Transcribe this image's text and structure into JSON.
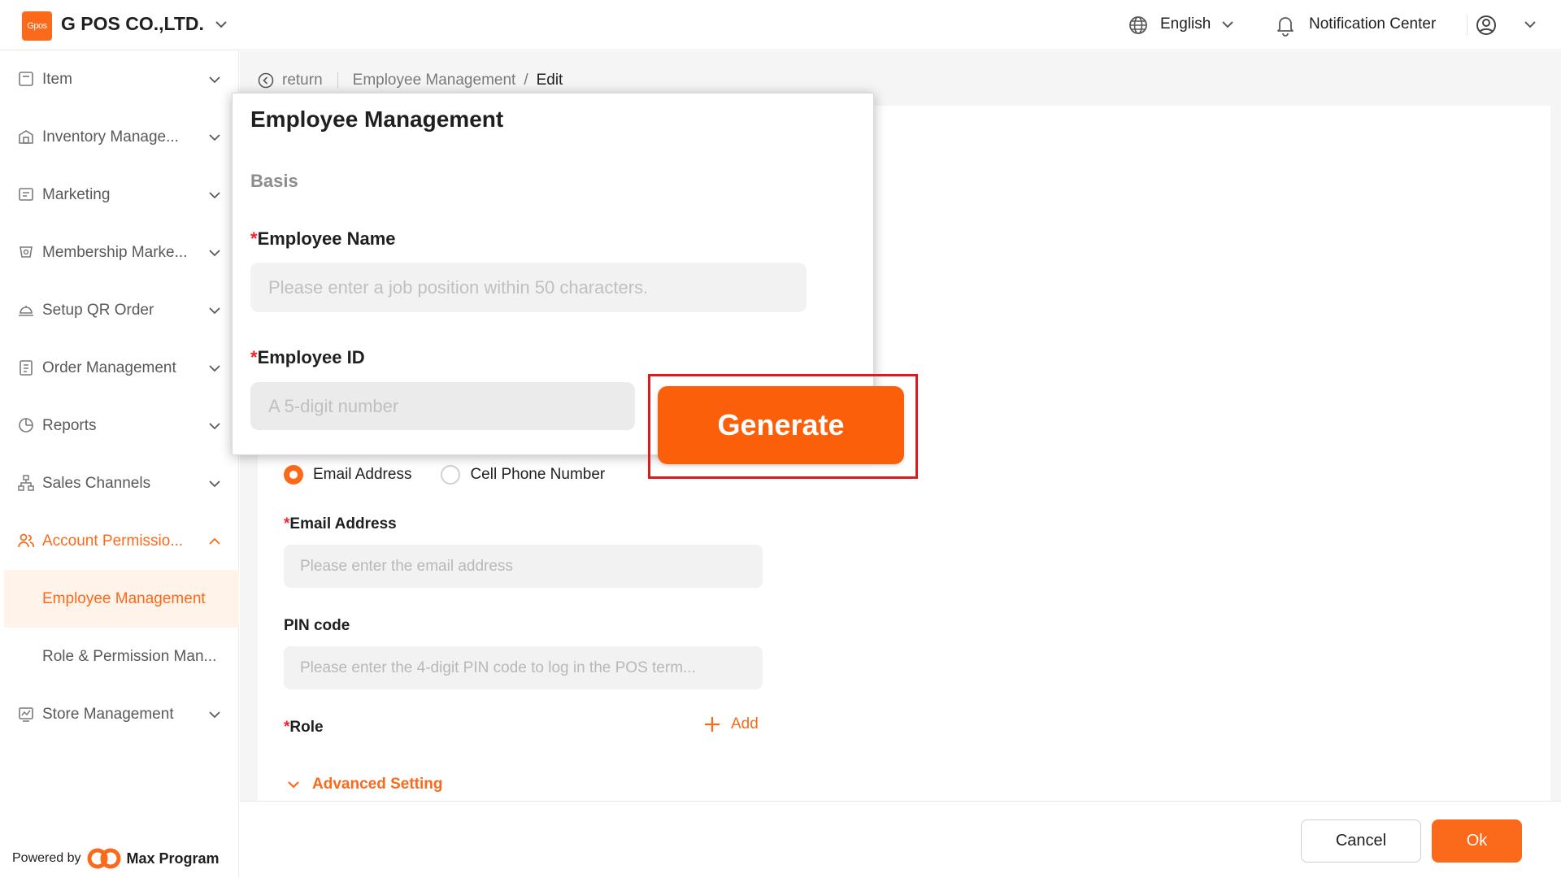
{
  "header": {
    "logo_text": "Gpos",
    "company_name": "G POS CO.,LTD.",
    "language": "English",
    "notification_label": "Notification Center"
  },
  "sidebar": {
    "items": [
      {
        "label": "Item",
        "icon": "item-icon"
      },
      {
        "label": "Inventory Manage...",
        "icon": "inventory-icon"
      },
      {
        "label": "Marketing",
        "icon": "marketing-icon"
      },
      {
        "label": "Membership Marke...",
        "icon": "membership-icon"
      },
      {
        "label": "Setup QR Order",
        "icon": "qr-order-icon"
      },
      {
        "label": "Order Management",
        "icon": "order-icon"
      },
      {
        "label": "Reports",
        "icon": "reports-icon"
      },
      {
        "label": "Sales Channels",
        "icon": "sales-channels-icon"
      },
      {
        "label": "Account Permissio...",
        "icon": "account-icon"
      }
    ],
    "sub_items": [
      {
        "label": "Employee Management",
        "active": true
      },
      {
        "label": "Role & Permission Man...",
        "active": false
      }
    ],
    "store": {
      "label": "Store Management",
      "icon": "store-icon"
    },
    "powered_by": "Powered by",
    "brand": "Max Program"
  },
  "breadcrumb": {
    "return": "return",
    "parent": "Employee Management",
    "separator": "/",
    "current": "Edit"
  },
  "form": {
    "login_options": [
      "Email Address",
      "Cell Phone Number"
    ],
    "selected_login_option": "Email Address",
    "email_label": "Email Address",
    "email_placeholder": "Please enter the email address",
    "pin_label": "PIN code",
    "pin_placeholder": "Please enter the 4-digit PIN code to log in the POS term...",
    "role_label": "Role",
    "add_label": "Add",
    "advanced_label": "Advanced Setting",
    "required_mark": "*"
  },
  "footer": {
    "cancel": "Cancel",
    "ok": "Ok"
  },
  "popup": {
    "title": "Employee Management",
    "section": "Basis",
    "name_label": "Employee Name",
    "name_placeholder": "Please enter a job position within 50 characters.",
    "id_label": "Employee ID",
    "id_placeholder": "A 5-digit number",
    "generate": "Generate"
  },
  "colors": {
    "accent": "#fb6a1a",
    "highlight": "#e0191b",
    "required": "#f5222d"
  }
}
